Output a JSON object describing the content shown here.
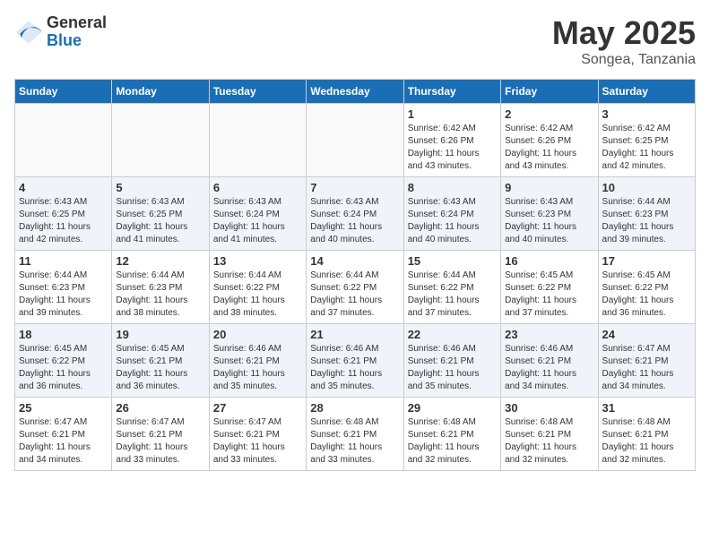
{
  "logo": {
    "general": "General",
    "blue": "Blue"
  },
  "title": {
    "month": "May 2025",
    "location": "Songea, Tanzania"
  },
  "weekdays": [
    "Sunday",
    "Monday",
    "Tuesday",
    "Wednesday",
    "Thursday",
    "Friday",
    "Saturday"
  ],
  "weeks": [
    [
      {
        "day": "",
        "content": ""
      },
      {
        "day": "",
        "content": ""
      },
      {
        "day": "",
        "content": ""
      },
      {
        "day": "",
        "content": ""
      },
      {
        "day": "1",
        "content": "Sunrise: 6:42 AM\nSunset: 6:26 PM\nDaylight: 11 hours\nand 43 minutes."
      },
      {
        "day": "2",
        "content": "Sunrise: 6:42 AM\nSunset: 6:26 PM\nDaylight: 11 hours\nand 43 minutes."
      },
      {
        "day": "3",
        "content": "Sunrise: 6:42 AM\nSunset: 6:25 PM\nDaylight: 11 hours\nand 42 minutes."
      }
    ],
    [
      {
        "day": "4",
        "content": "Sunrise: 6:43 AM\nSunset: 6:25 PM\nDaylight: 11 hours\nand 42 minutes."
      },
      {
        "day": "5",
        "content": "Sunrise: 6:43 AM\nSunset: 6:25 PM\nDaylight: 11 hours\nand 41 minutes."
      },
      {
        "day": "6",
        "content": "Sunrise: 6:43 AM\nSunset: 6:24 PM\nDaylight: 11 hours\nand 41 minutes."
      },
      {
        "day": "7",
        "content": "Sunrise: 6:43 AM\nSunset: 6:24 PM\nDaylight: 11 hours\nand 40 minutes."
      },
      {
        "day": "8",
        "content": "Sunrise: 6:43 AM\nSunset: 6:24 PM\nDaylight: 11 hours\nand 40 minutes."
      },
      {
        "day": "9",
        "content": "Sunrise: 6:43 AM\nSunset: 6:23 PM\nDaylight: 11 hours\nand 40 minutes."
      },
      {
        "day": "10",
        "content": "Sunrise: 6:44 AM\nSunset: 6:23 PM\nDaylight: 11 hours\nand 39 minutes."
      }
    ],
    [
      {
        "day": "11",
        "content": "Sunrise: 6:44 AM\nSunset: 6:23 PM\nDaylight: 11 hours\nand 39 minutes."
      },
      {
        "day": "12",
        "content": "Sunrise: 6:44 AM\nSunset: 6:23 PM\nDaylight: 11 hours\nand 38 minutes."
      },
      {
        "day": "13",
        "content": "Sunrise: 6:44 AM\nSunset: 6:22 PM\nDaylight: 11 hours\nand 38 minutes."
      },
      {
        "day": "14",
        "content": "Sunrise: 6:44 AM\nSunset: 6:22 PM\nDaylight: 11 hours\nand 37 minutes."
      },
      {
        "day": "15",
        "content": "Sunrise: 6:44 AM\nSunset: 6:22 PM\nDaylight: 11 hours\nand 37 minutes."
      },
      {
        "day": "16",
        "content": "Sunrise: 6:45 AM\nSunset: 6:22 PM\nDaylight: 11 hours\nand 37 minutes."
      },
      {
        "day": "17",
        "content": "Sunrise: 6:45 AM\nSunset: 6:22 PM\nDaylight: 11 hours\nand 36 minutes."
      }
    ],
    [
      {
        "day": "18",
        "content": "Sunrise: 6:45 AM\nSunset: 6:22 PM\nDaylight: 11 hours\nand 36 minutes."
      },
      {
        "day": "19",
        "content": "Sunrise: 6:45 AM\nSunset: 6:21 PM\nDaylight: 11 hours\nand 36 minutes."
      },
      {
        "day": "20",
        "content": "Sunrise: 6:46 AM\nSunset: 6:21 PM\nDaylight: 11 hours\nand 35 minutes."
      },
      {
        "day": "21",
        "content": "Sunrise: 6:46 AM\nSunset: 6:21 PM\nDaylight: 11 hours\nand 35 minutes."
      },
      {
        "day": "22",
        "content": "Sunrise: 6:46 AM\nSunset: 6:21 PM\nDaylight: 11 hours\nand 35 minutes."
      },
      {
        "day": "23",
        "content": "Sunrise: 6:46 AM\nSunset: 6:21 PM\nDaylight: 11 hours\nand 34 minutes."
      },
      {
        "day": "24",
        "content": "Sunrise: 6:47 AM\nSunset: 6:21 PM\nDaylight: 11 hours\nand 34 minutes."
      }
    ],
    [
      {
        "day": "25",
        "content": "Sunrise: 6:47 AM\nSunset: 6:21 PM\nDaylight: 11 hours\nand 34 minutes."
      },
      {
        "day": "26",
        "content": "Sunrise: 6:47 AM\nSunset: 6:21 PM\nDaylight: 11 hours\nand 33 minutes."
      },
      {
        "day": "27",
        "content": "Sunrise: 6:47 AM\nSunset: 6:21 PM\nDaylight: 11 hours\nand 33 minutes."
      },
      {
        "day": "28",
        "content": "Sunrise: 6:48 AM\nSunset: 6:21 PM\nDaylight: 11 hours\nand 33 minutes."
      },
      {
        "day": "29",
        "content": "Sunrise: 6:48 AM\nSunset: 6:21 PM\nDaylight: 11 hours\nand 32 minutes."
      },
      {
        "day": "30",
        "content": "Sunrise: 6:48 AM\nSunset: 6:21 PM\nDaylight: 11 hours\nand 32 minutes."
      },
      {
        "day": "31",
        "content": "Sunrise: 6:48 AM\nSunset: 6:21 PM\nDaylight: 11 hours\nand 32 minutes."
      }
    ]
  ]
}
